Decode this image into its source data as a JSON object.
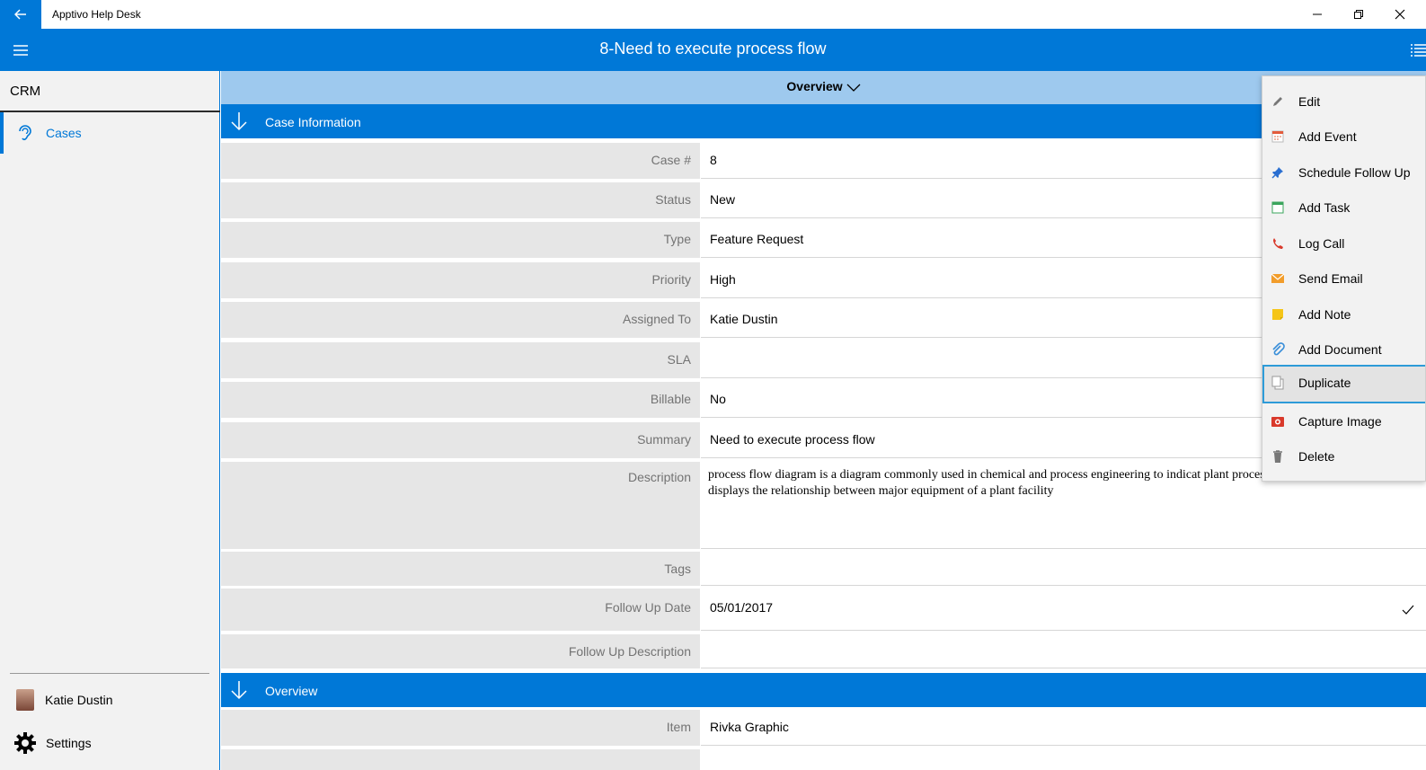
{
  "window": {
    "app_title": "Apptivo Help Desk"
  },
  "header": {
    "title": "8-Need to execute process flow"
  },
  "sidebar": {
    "section_label": "CRM",
    "items": [
      {
        "label": "Cases",
        "icon": "ear-icon"
      }
    ],
    "user_name": "Katie Dustin",
    "settings_label": "Settings"
  },
  "main": {
    "view_selector": "Overview",
    "sections": [
      {
        "label": "Case Information"
      },
      {
        "label": "Overview"
      }
    ],
    "fields": [
      {
        "label": "Case #",
        "value": "8"
      },
      {
        "label": "Status",
        "value": "New"
      },
      {
        "label": "Type",
        "value": "Feature Request"
      },
      {
        "label": "Priority",
        "value": "High"
      },
      {
        "label": "Assigned To",
        "value": "Katie Dustin"
      },
      {
        "label": "SLA",
        "value": ""
      },
      {
        "label": "Billable",
        "value": "No"
      },
      {
        "label": "Summary",
        "value": "Need to execute process flow"
      },
      {
        "label": "Description",
        "value": "process flow diagram is a diagram commonly used in chemical and process engineering to indicat plant processes and equipment. The PFD displays the relationship between major equipment of a plant facility"
      },
      {
        "label": "Tags",
        "value": ""
      },
      {
        "label": "Follow Up Date",
        "value": "05/01/2017"
      },
      {
        "label": "Follow Up Description",
        "value": ""
      }
    ],
    "overview_fields": [
      {
        "label": "Item",
        "value": "Rivka Graphic"
      }
    ]
  },
  "context_menu": {
    "items": [
      {
        "label": "Edit",
        "icon": "pencil-icon"
      },
      {
        "label": "Add Event",
        "icon": "calendar-icon"
      },
      {
        "label": "Schedule Follow Up",
        "icon": "pin-icon"
      },
      {
        "label": "Add Task",
        "icon": "task-calendar-icon"
      },
      {
        "label": "Log Call",
        "icon": "phone-icon"
      },
      {
        "label": "Send Email",
        "icon": "envelope-icon"
      },
      {
        "label": "Add Note",
        "icon": "note-icon"
      },
      {
        "label": "Add Document",
        "icon": "paperclip-icon"
      },
      {
        "label": "Duplicate",
        "icon": "copy-icon"
      },
      {
        "label": "Capture Image",
        "icon": "camera-icon"
      },
      {
        "label": "Delete",
        "icon": "trash-icon"
      }
    ],
    "selected": "Duplicate"
  },
  "colors": {
    "accent": "#0078d7",
    "overview_bar": "#9ec9ee",
    "label_bg": "#e6e6e6",
    "sidebar_bg": "#f2f2f2"
  }
}
